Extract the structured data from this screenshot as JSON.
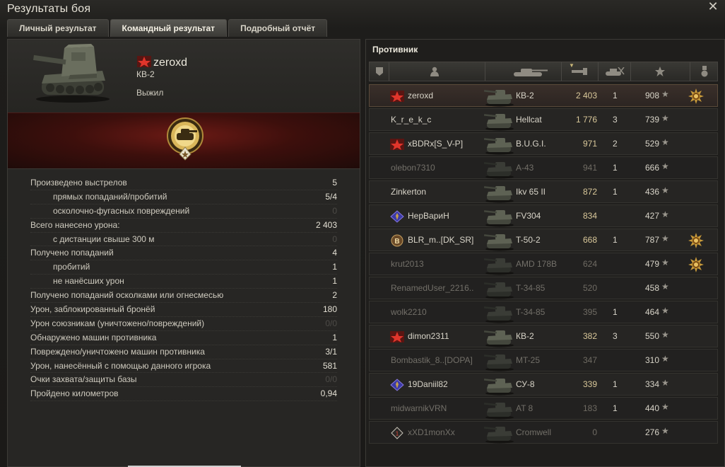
{
  "window": {
    "title": "Результаты боя",
    "close_symbol": "✕"
  },
  "tabs": [
    {
      "label": "Личный результат",
      "active": false
    },
    {
      "label": "Командный результат",
      "active": true
    },
    {
      "label": "Подробный отчёт",
      "active": false
    }
  ],
  "player": {
    "name": "zeroxd",
    "vehicle": "КВ-2",
    "status": "Выжил"
  },
  "stats": [
    {
      "label": "Произведено выстрелов",
      "value": "5",
      "indent": false,
      "dim": false
    },
    {
      "label": "прямых попаданий/пробитий",
      "value": "5/4",
      "indent": true,
      "dim": false
    },
    {
      "label": "осколочно-фугасных повреждений",
      "value": "0",
      "indent": true,
      "dim": true
    },
    {
      "label": "Всего нанесено урона:",
      "value": "2 403",
      "indent": false,
      "dim": false
    },
    {
      "label": "с дистанции свыше 300 м",
      "value": "0",
      "indent": true,
      "dim": true
    },
    {
      "label": "Получено попаданий",
      "value": "4",
      "indent": false,
      "dim": false
    },
    {
      "label": "пробитий",
      "value": "1",
      "indent": true,
      "dim": false
    },
    {
      "label": "не нанёсших урон",
      "value": "1",
      "indent": true,
      "dim": false
    },
    {
      "label": "Получено попаданий осколками или огнесмесью",
      "value": "2",
      "indent": false,
      "dim": false
    },
    {
      "label": "Урон, заблокированный бронёй",
      "value": "180",
      "indent": false,
      "dim": false
    },
    {
      "label": "Урон союзникам (уничтожено/повреждений)",
      "value": "0/0",
      "indent": false,
      "dim": true
    },
    {
      "label": "Обнаружено машин противника",
      "value": "1",
      "indent": false,
      "dim": false
    },
    {
      "label": "Повреждено/уничтожено машин противника",
      "value": "3/1",
      "indent": false,
      "dim": false
    },
    {
      "label": "Урон, нанесённый с помощью данного игрока",
      "value": "581",
      "indent": false,
      "dim": false
    },
    {
      "label": "Очки захвата/защиты базы",
      "value": "0/0",
      "indent": false,
      "dim": true
    },
    {
      "label": "Пройдено километров",
      "value": "0,94",
      "indent": false,
      "dim": false
    }
  ],
  "team_panel": {
    "title": "Противник",
    "header_icons": [
      "squad-icon",
      "player-icon",
      "tank-icon",
      "damage-icon",
      "kills-icon",
      "xp-star-icon",
      "medal-icon"
    ]
  },
  "players": [
    {
      "name": "zeroxd",
      "vehicle": "КВ-2",
      "damage": "2 403",
      "kills": "1",
      "xp": "908",
      "badge": "red-star",
      "medal": true,
      "dead": false,
      "self": true
    },
    {
      "name": "K_r_e_k_c",
      "vehicle": "Hellcat",
      "damage": "1 776",
      "kills": "3",
      "xp": "739",
      "badge": "",
      "medal": false,
      "dead": false,
      "self": false
    },
    {
      "name": "xBDRx[S_V-P]",
      "vehicle": "B.U.G.I.",
      "damage": "971",
      "kills": "2",
      "xp": "529",
      "badge": "red-star",
      "medal": false,
      "dead": false,
      "self": false
    },
    {
      "name": "olebon7310",
      "vehicle": "A-43",
      "damage": "941",
      "kills": "1",
      "xp": "666",
      "badge": "",
      "medal": false,
      "dead": true,
      "self": false
    },
    {
      "name": "Zinkerton",
      "vehicle": "Ikv 65 II",
      "damage": "872",
      "kills": "1",
      "xp": "436",
      "badge": "",
      "medal": false,
      "dead": false,
      "self": false
    },
    {
      "name": "НерВариН",
      "vehicle": "FV304",
      "damage": "834",
      "kills": "",
      "xp": "427",
      "badge": "diamond",
      "medal": false,
      "dead": false,
      "self": false
    },
    {
      "name": "BLR_m..[DK_SR]",
      "vehicle": "T-50-2",
      "damage": "668",
      "kills": "1",
      "xp": "787",
      "badge": "b-circle",
      "medal": true,
      "dead": false,
      "self": false
    },
    {
      "name": "krut2013",
      "vehicle": "AMD 178B",
      "damage": "624",
      "kills": "",
      "xp": "479",
      "badge": "",
      "medal": true,
      "dead": true,
      "self": false
    },
    {
      "name": "RenamedUser_2216..",
      "vehicle": "T-34-85",
      "damage": "520",
      "kills": "",
      "xp": "458",
      "badge": "",
      "medal": false,
      "dead": true,
      "self": false
    },
    {
      "name": "wolk2210",
      "vehicle": "T-34-85",
      "damage": "395",
      "kills": "1",
      "xp": "464",
      "badge": "",
      "medal": false,
      "dead": true,
      "self": false
    },
    {
      "name": "dimon2311",
      "vehicle": "КВ-2",
      "damage": "382",
      "kills": "3",
      "xp": "550",
      "badge": "red-star",
      "medal": false,
      "dead": false,
      "self": false
    },
    {
      "name": "Bombastik_8..[DOPA]",
      "vehicle": "MT-25",
      "damage": "347",
      "kills": "",
      "xp": "310",
      "badge": "",
      "medal": false,
      "dead": true,
      "self": false
    },
    {
      "name": "19Daniil82",
      "vehicle": "СУ-8",
      "damage": "339",
      "kills": "1",
      "xp": "334",
      "badge": "diamond",
      "medal": false,
      "dead": false,
      "self": false
    },
    {
      "name": "midwarnikVRN",
      "vehicle": "AT 8",
      "damage": "183",
      "kills": "1",
      "xp": "440",
      "badge": "",
      "medal": false,
      "dead": true,
      "self": false
    },
    {
      "name": "xXD1monXx",
      "vehicle": "Cromwell",
      "damage": "0",
      "kills": "",
      "xp": "276",
      "badge": "rhombus-1",
      "medal": false,
      "dead": true,
      "self": false
    }
  ],
  "xp_star_symbol": "★"
}
